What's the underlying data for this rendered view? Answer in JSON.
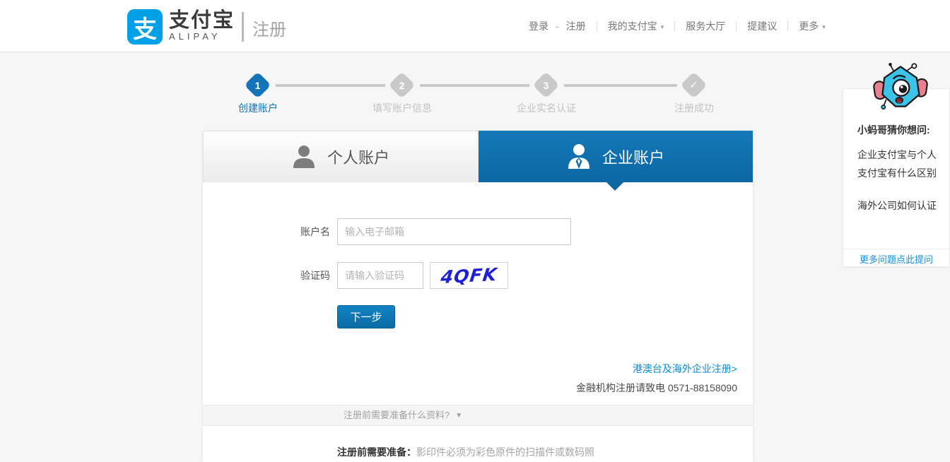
{
  "header": {
    "logo_glyph": "支",
    "brand_cn": "支付宝",
    "brand_en": "ALIPAY",
    "page_title": "注册",
    "nav": {
      "login": "登录",
      "dash": "-",
      "register": "注册",
      "my_alipay": "我的支付宝",
      "service_hall": "服务大厅",
      "feedback": "提建议",
      "more": "更多"
    }
  },
  "icons": {
    "caret_down": "▾",
    "toggle_caret": "▼",
    "check": "✓"
  },
  "steps": {
    "items": [
      {
        "marker": "1",
        "label": "创建账户"
      },
      {
        "marker": "2",
        "label": "填写账户信息"
      },
      {
        "marker": "3",
        "label": "企业实名认证"
      },
      {
        "marker": "✓",
        "label": "注册成功"
      }
    ]
  },
  "tabs": {
    "personal": "个人账户",
    "enterprise": "企业账户"
  },
  "form": {
    "account_label": "账户名",
    "account_placeholder": "输入电子邮箱",
    "captcha_label": "验证码",
    "captcha_placeholder": "请输入验证码",
    "captcha_text": "4QFK",
    "next_button": "下一步",
    "overseas_link": "港澳台及海外企业注册>",
    "finance_note": "金融机构注册请致电 0571-88158090"
  },
  "prep": {
    "toggle_text": "注册前需要准备什么资料?",
    "note_label": "注册前需要准备：",
    "note_text": "影印件必须为彩色原件的扫描件或数码照"
  },
  "assistant": {
    "title": "小蚂哥猜你想问:",
    "questions": [
      "企业支付宝与个人支付宝有什么区别",
      "海外公司如何认证"
    ],
    "more_link": "更多问题点此提问"
  },
  "colors": {
    "brand_blue": "#00a0e9",
    "active_blue": "#1474b8",
    "tab_gradient_bottom": "#0c67a3",
    "link_blue": "#0a8fd8",
    "captcha_ink": "#1f1fd4",
    "page_bg": "#f6f6f7"
  }
}
